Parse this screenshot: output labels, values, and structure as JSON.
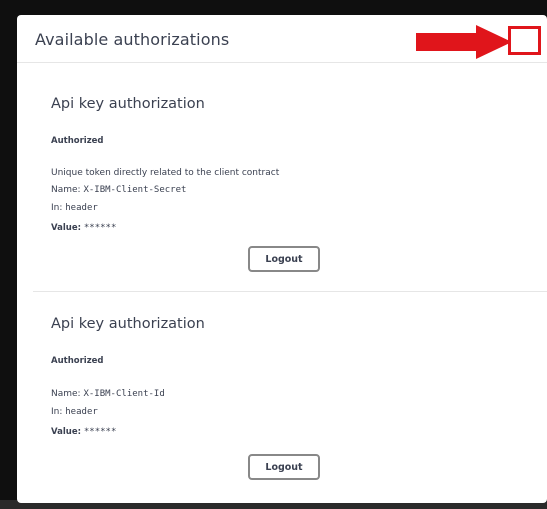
{
  "modal": {
    "title": "Available authorizations"
  },
  "auths": [
    {
      "title": "Api key authorization",
      "status": "Authorized",
      "description": "Unique token directly related to the client contract",
      "name_label": "Name:",
      "name_value": "X-IBM-Client-Secret",
      "in_label": "In:",
      "in_value": "header",
      "value_label": "Value:",
      "value_value": "******",
      "logout_label": "Logout"
    },
    {
      "title": "Api key authorization",
      "status": "Authorized",
      "name_label": "Name:",
      "name_value": "X-IBM-Client-Id",
      "in_label": "In:",
      "in_value": "header",
      "value_label": "Value:",
      "value_value": "******",
      "logout_label": "Logout"
    }
  ],
  "colors": {
    "annotation_red": "#e0151b",
    "text": "#3b4151",
    "backdrop": "#0f0f0f"
  }
}
